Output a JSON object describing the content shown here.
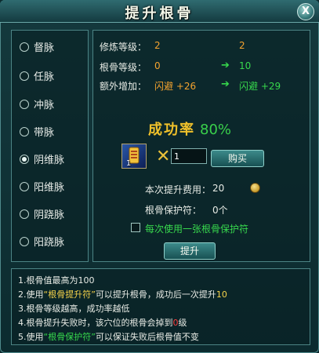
{
  "window": {
    "title": "提升根骨",
    "close_label": "X"
  },
  "meridians": [
    {
      "label": "督脉",
      "selected": false
    },
    {
      "label": "任脉",
      "selected": false
    },
    {
      "label": "冲脉",
      "selected": false
    },
    {
      "label": "带脉",
      "selected": false
    },
    {
      "label": "阴维脉",
      "selected": true
    },
    {
      "label": "阳维脉",
      "selected": false
    },
    {
      "label": "阴跷脉",
      "selected": false
    },
    {
      "label": "阳跷脉",
      "selected": false
    }
  ],
  "stats": {
    "cultivation": {
      "label": "修炼等级：",
      "current": "2",
      "next": "2"
    },
    "root_bone": {
      "label": "根骨等级：",
      "current": "0",
      "next": "10"
    },
    "bonus": {
      "label": "额外增加：",
      "current": "闪避 +26",
      "next": "闪避 +29"
    },
    "arrow": "➔"
  },
  "success": {
    "label": "成功率",
    "value": "80%"
  },
  "item": {
    "icon": "scroll-item-icon",
    "count": "1",
    "times": "✕",
    "quantity": "1"
  },
  "buy_label": "购买",
  "cost": {
    "label": "本次提升费用：",
    "value": "20"
  },
  "protect": {
    "label": "根骨保护符：",
    "value": "0个"
  },
  "use_protect_label": "每次使用一张根骨保护符",
  "upgrade_label": "提升",
  "notes": {
    "n1": "1.根骨值最高为100",
    "n2a": "2.使用",
    "n2b": "“根骨提升符”",
    "n2c": "可以提升根骨，成功后一次提升",
    "n2d": "10",
    "n3": "3.根骨等级越高，成功率越低",
    "n4a": "4.根骨提升失败时，该穴位的根骨会掉到",
    "n4b": "0",
    "n4c": "级",
    "n5a": "5.使用",
    "n5b": "“根骨保护符”",
    "n5c": "可以保证失败后根骨值不变"
  },
  "colors": {
    "orange": "#f4a32f",
    "green": "#37d84d",
    "gold": "#f0c12b",
    "red": "#ff3b3b"
  }
}
